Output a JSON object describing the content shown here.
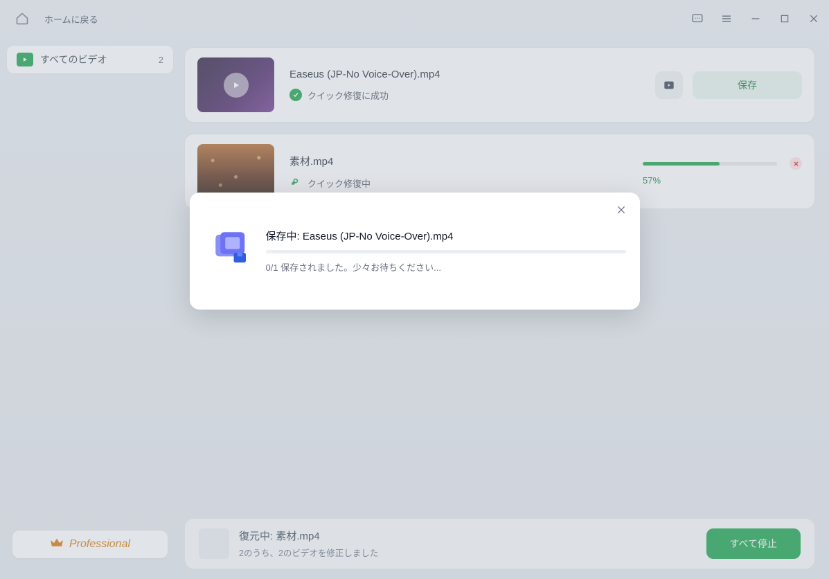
{
  "titlebar": {
    "back_label": "ホームに戻る"
  },
  "sidebar": {
    "item": {
      "label": "すべてのビデオ",
      "count": "2"
    },
    "pro_label": "Professional"
  },
  "files": [
    {
      "name": "Easeus (JP-No Voice-Over).mp4",
      "status": "クイック修復に成功",
      "save_label": "保存"
    },
    {
      "name": "素材.mp4",
      "status": "クイック修復中",
      "progress_pct": 57,
      "progress_label": "57%"
    }
  ],
  "footer": {
    "line1": "復元中: 素材.mp4",
    "line2": "2のうち、2のビデオを修正しました",
    "stop_label": "すべて停止"
  },
  "modal": {
    "title": "保存中: Easeus (JP-No Voice-Over).mp4",
    "subtitle": "0/1 保存されました。少々お待ちください..."
  }
}
